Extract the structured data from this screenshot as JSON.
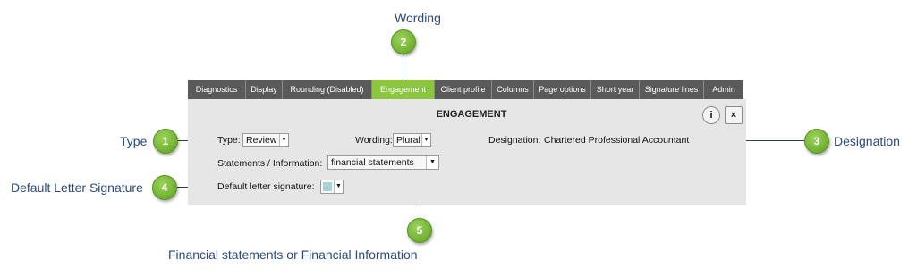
{
  "callouts": {
    "wording": {
      "text": "Wording",
      "num": "2"
    },
    "type": {
      "text": "Type",
      "num": "1"
    },
    "designation": {
      "text": "Designation",
      "num": "3"
    },
    "default_letter_signature": {
      "text": "Default Letter Signature",
      "num": "4"
    },
    "financial": {
      "text": "Financial statements or Financial Information",
      "num": "5"
    }
  },
  "tabs": [
    {
      "label": "Diagnostics"
    },
    {
      "label": "Display"
    },
    {
      "label": "Rounding (Disabled)"
    },
    {
      "label": "Engagement"
    },
    {
      "label": "Client profile"
    },
    {
      "label": "Columns"
    },
    {
      "label": "Page options"
    },
    {
      "label": "Short year"
    },
    {
      "label": "Signature lines"
    },
    {
      "label": "Admin"
    }
  ],
  "active_tab": "Engagement",
  "panel": {
    "title": "ENGAGEMENT",
    "info_icon": "i",
    "close_icon": "×"
  },
  "form": {
    "type_label": "Type:",
    "type_value": "Review",
    "wording_label": "Wording:",
    "wording_value": "Plural",
    "designation_label": "Designation:",
    "designation_value": "Chartered Professional Accountant",
    "statements_label": "Statements / Information:",
    "statements_value": "financial statements",
    "signature_label": "Default letter signature:"
  },
  "colors": {
    "accent": "#8cc63f",
    "tab_bg": "#5a5a5a",
    "panel_bg": "#e6e6e6",
    "callout_text": "#2b4a7e"
  }
}
